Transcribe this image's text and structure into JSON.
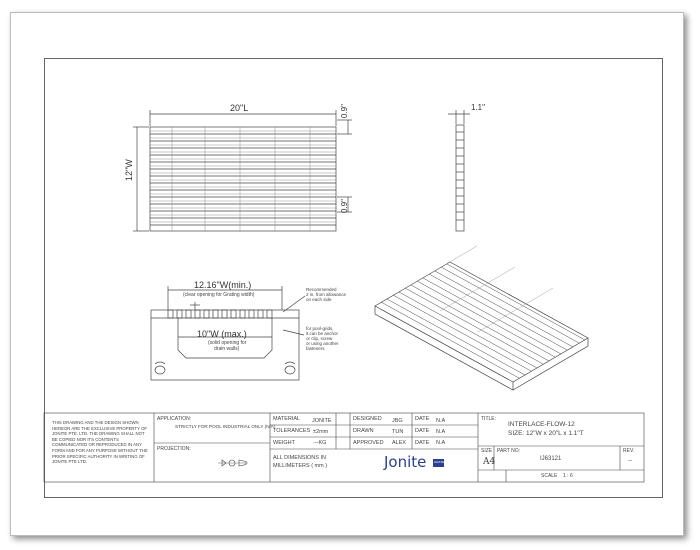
{
  "dimensions": {
    "length": "20\"L",
    "width": "12\"W",
    "depth": "1.1\"",
    "bar_top": "0.9\"",
    "bar_bottom": "0.9\"",
    "min_width": "12.16\"W(min.)",
    "clear_opening": "(clear opening for Grating width)",
    "max_width": "10\"W (max.)",
    "solid_opening_1": "(solid opening for",
    "solid_opening_2": "drain walls)",
    "note_recommend_1": "Recommended",
    "note_recommend_2": "2 in. from allowance",
    "note_recommend_3": "on each side",
    "note_grip_1": "for pool-grids,",
    "note_grip_2": "it can be anchor",
    "note_grip_3": "or clip, screw",
    "note_grip_4": "or using another",
    "note_grip_5": "fasteners"
  },
  "title_block": {
    "disclaimer": "THIS DRAWING AND THE DESIGN SHOWN HEREON ARE THE EXCLUSIVE PROPERTY OF JONITE PTE. LTD. THE DRAWING SHALL NOT BE COPIED NOR ITS CONTENTS COMMUNICATED OR REPRODUCED IN ANY FORM AND FOR ANY PURPOSE WITHOUT THE PRIOR SPECIFIC AUTHORITY IN WRITING OF JONITE PTE LTD.",
    "application_label": "APPLICATION:",
    "application_value": "STRICTLY FOR POOL INDUSTRIAL ONLY (N/A)",
    "projection_label": "PROJECTION:",
    "material_label": "MATERIAL",
    "material_value": "JONITE",
    "tolerances_label": "TOLERANCES",
    "tolerances_value": "±2mm",
    "weight_label": "WEIGHT",
    "weight_value": "---KG",
    "dims_note_1": "ALL DIMENSIONS IN",
    "dims_note_2": "MILLIMETERS ( mm )",
    "designed_label": "DESIGNED",
    "designed_value": "JBG",
    "drawn_label": "DRAWN",
    "drawn_value": "TUN",
    "approved_label": "APPROVED",
    "approved_value": "ALEX",
    "date_label": "DATE",
    "date_value": "N.A",
    "logo_text": "Jonite",
    "logo_badge": "GRATE",
    "title_label": "TITLE:",
    "title_line1": "INTERLACE-FLOW-12",
    "title_line2": "SIZE: 12\"W x 20\"L x 1.1\"T",
    "size_label": "SIZE",
    "size_value": "A4",
    "part_no_label": "PART NO:",
    "part_no_value": "IJ63121",
    "rev_label": "REV.",
    "rev_value": "--",
    "scale_label": "SCALE",
    "scale_value": "1 : 6"
  }
}
